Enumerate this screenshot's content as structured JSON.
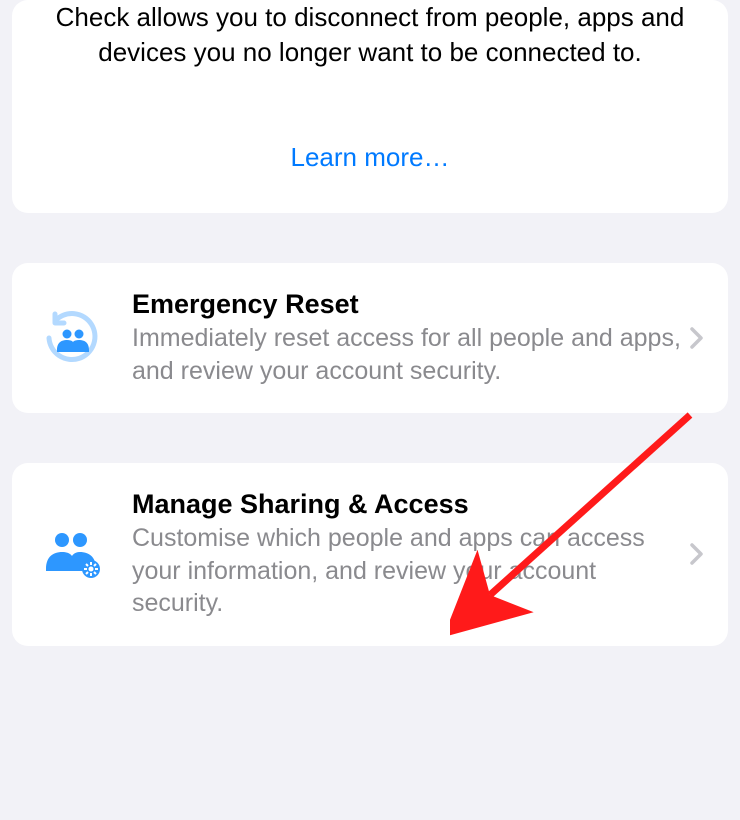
{
  "intro": {
    "description": "Check allows you to disconnect from people, apps and devices you no longer want to be connected to.",
    "learn_more_label": "Learn more…"
  },
  "options": [
    {
      "title": "Emergency Reset",
      "subtitle": "Immediately reset access for all people and apps, and review your account security."
    },
    {
      "title": "Manage Sharing & Access",
      "subtitle": "Customise which people and apps can access your information, and review your account security."
    }
  ],
  "colors": {
    "link": "#007aff",
    "secondary_text": "#8a8a8e",
    "chevron": "#c7c7cc",
    "annotation": "#ff1a1a"
  }
}
